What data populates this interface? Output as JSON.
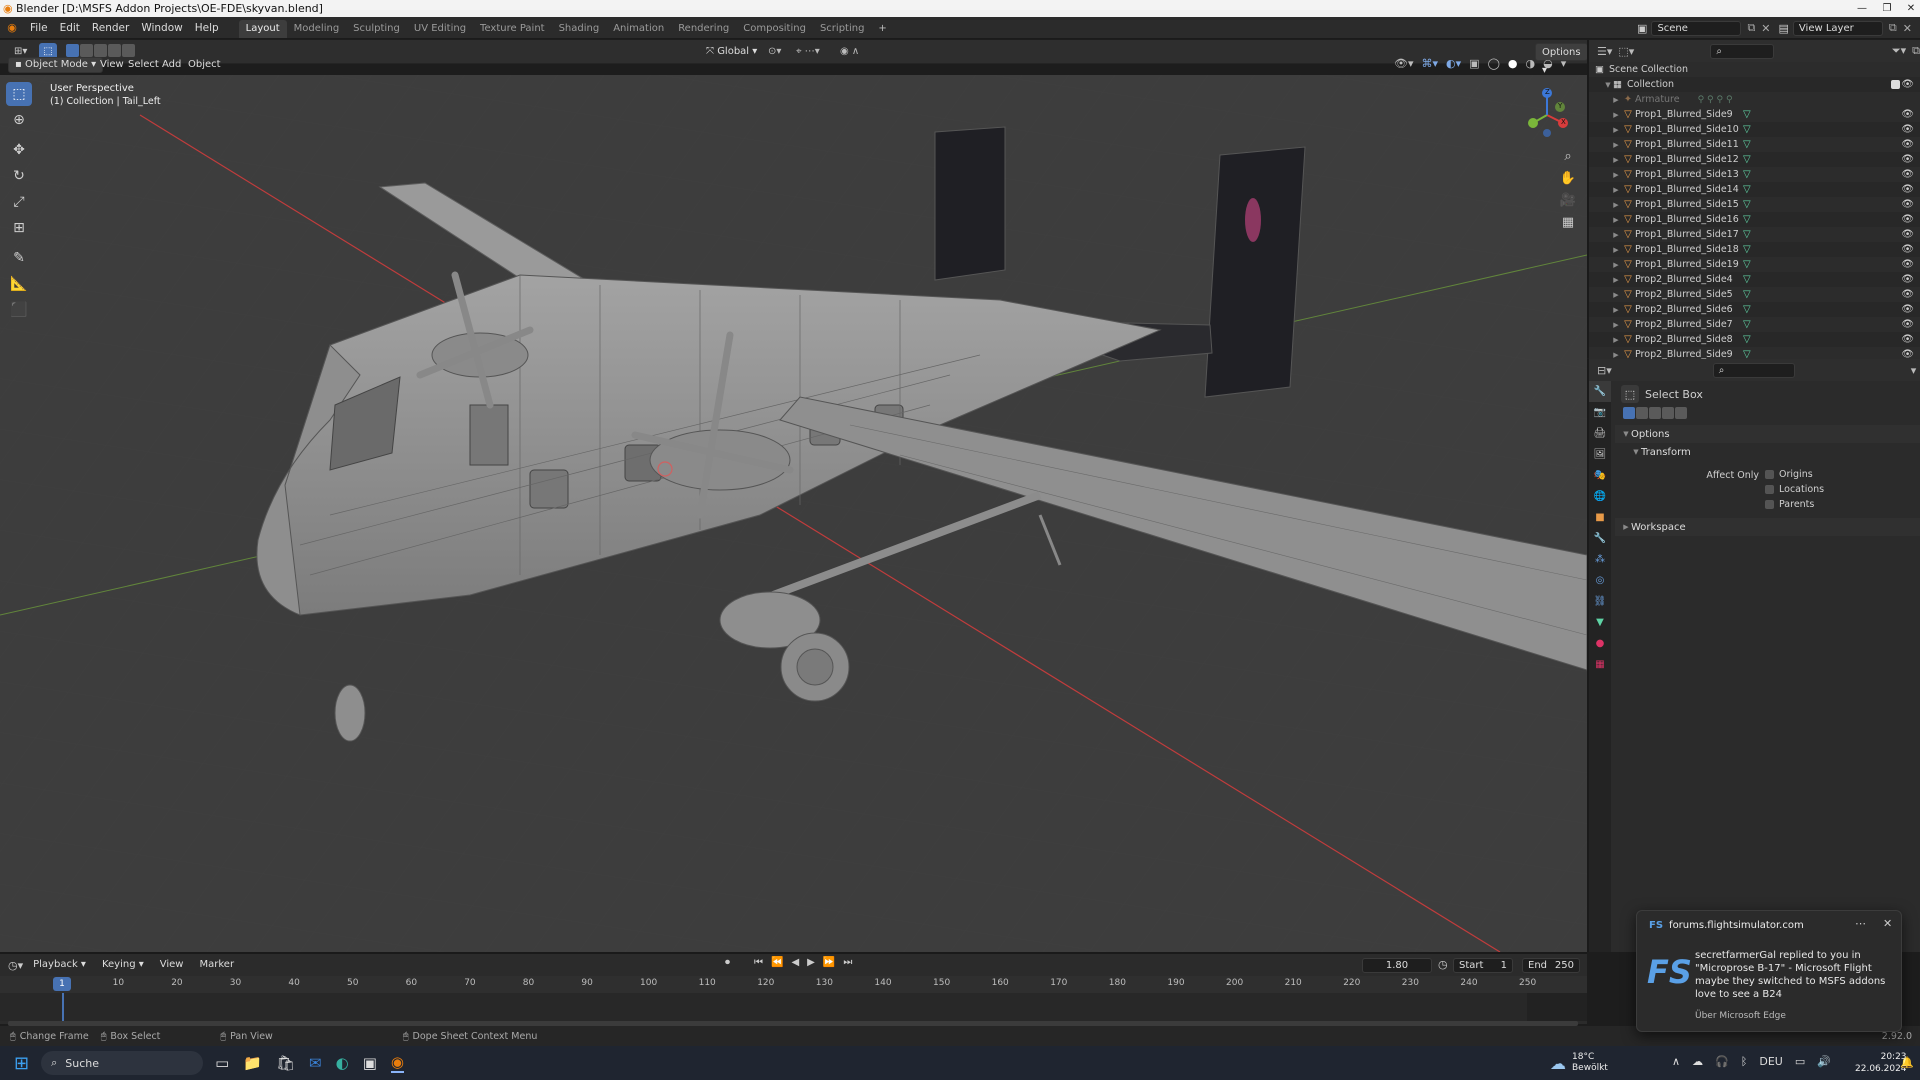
{
  "window": {
    "title": "Blender [D:\\MSFS Addon Projects\\OE-FDE\\skyvan.blend]"
  },
  "menus": [
    "File",
    "Edit",
    "Render",
    "Window",
    "Help"
  ],
  "workspaces": [
    "Layout",
    "Modeling",
    "Sculpting",
    "UV Editing",
    "Texture Paint",
    "Shading",
    "Animation",
    "Rendering",
    "Compositing",
    "Scripting"
  ],
  "active_workspace": "Layout",
  "scene": {
    "name": "Scene",
    "view_layer": "View Layer"
  },
  "viewport_header": {
    "mode": "Object Mode",
    "menus": [
      "View",
      "Select",
      "Add",
      "Object"
    ],
    "orientation": "Global",
    "options_label": "Options"
  },
  "viewport": {
    "perspective": "User Perspective",
    "context": "(1) Collection | Tail_Left"
  },
  "gizmo_axes": {
    "x": "X",
    "y": "Y",
    "z": "Z"
  },
  "outliner": {
    "root": "Scene Collection",
    "collection": "Collection",
    "armature": "Armature",
    "items": [
      "Prop1_Blurred_Side9",
      "Prop1_Blurred_Side10",
      "Prop1_Blurred_Side11",
      "Prop1_Blurred_Side12",
      "Prop1_Blurred_Side13",
      "Prop1_Blurred_Side14",
      "Prop1_Blurred_Side15",
      "Prop1_Blurred_Side16",
      "Prop1_Blurred_Side17",
      "Prop1_Blurred_Side18",
      "Prop1_Blurred_Side19",
      "Prop2_Blurred_Side4",
      "Prop2_Blurred_Side5",
      "Prop2_Blurred_Side6",
      "Prop2_Blurred_Side7",
      "Prop2_Blurred_Side8",
      "Prop2_Blurred_Side9"
    ]
  },
  "properties": {
    "tool_name": "Select Box",
    "options": "Options",
    "transform": "Transform",
    "affect_only": "Affect Only",
    "checks": [
      "Origins",
      "Locations",
      "Parents"
    ],
    "workspace": "Workspace"
  },
  "timeline": {
    "menus": [
      "Playback",
      "Keying",
      "View",
      "Marker"
    ],
    "current_frame_field": "1.80",
    "start_label": "Start",
    "start": "1",
    "end_label": "End",
    "end": "250",
    "current_frame": "1",
    "ticks": [
      "10",
      "20",
      "30",
      "40",
      "50",
      "60",
      "70",
      "80",
      "90",
      "100",
      "110",
      "120",
      "130",
      "140",
      "150",
      "160",
      "170",
      "180",
      "190",
      "200",
      "210",
      "220",
      "230",
      "240",
      "250"
    ]
  },
  "statusbar": {
    "items": [
      "Change Frame",
      "Box Select",
      "Pan View",
      "Dope Sheet Context Menu"
    ],
    "version": "2.92.0"
  },
  "toast": {
    "source": "forums.flightsimulator.com",
    "logo": "FS",
    "message": "secretfarmerGal replied to you in \"Microprose B-17\" - Microsoft Flight maybe they switched to MSFS addons love to see a B24",
    "via": "Über Microsoft Edge"
  },
  "taskbar": {
    "search": "Suche",
    "weather_temp": "18°C",
    "weather_desc": "Bewölkt",
    "lang": "DEU",
    "time": "20:23",
    "date": "22.06.2024"
  },
  "colors": {
    "accent": "#4772b3",
    "object": "#e89a48",
    "mesh": "#5fd3a5",
    "axis_x": "#d83c3c",
    "axis_y": "#7ab63a"
  }
}
